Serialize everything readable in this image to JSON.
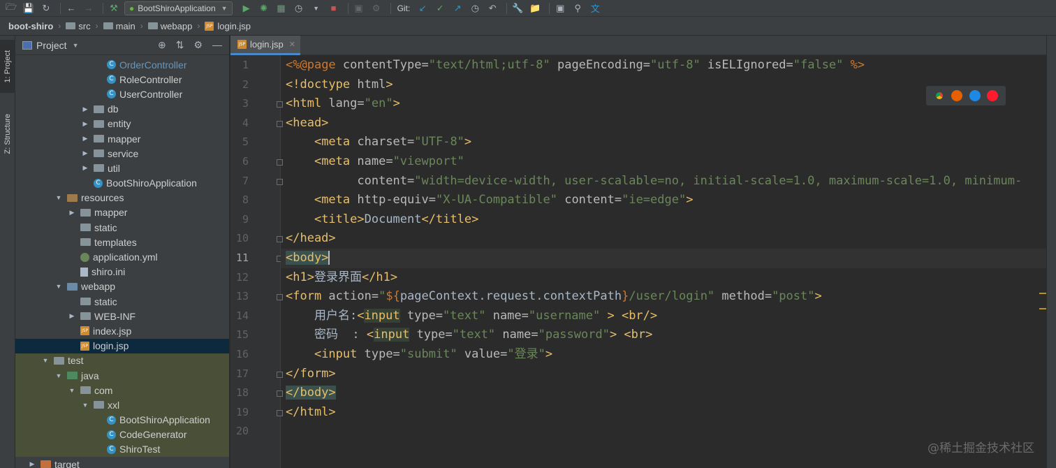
{
  "toolbar": {
    "run_config": "BootShiroApplication",
    "git_label": "Git:"
  },
  "breadcrumb": [
    "boot-shiro",
    "src",
    "main",
    "webapp",
    "login.jsp"
  ],
  "left_stripe": {
    "project_tab": "1: Project",
    "structure_tab": "Z: Structure"
  },
  "project_panel": {
    "title": "Project",
    "tree": [
      {
        "label": "OrderController",
        "icon": "class-icon",
        "depth": 4,
        "arrow": "",
        "style": "link"
      },
      {
        "label": "RoleController",
        "icon": "class-icon",
        "depth": 4,
        "arrow": "",
        "style": ""
      },
      {
        "label": "UserController",
        "icon": "class-icon",
        "depth": 4,
        "arrow": "",
        "style": ""
      },
      {
        "label": "db",
        "icon": "folder-icon",
        "depth": 3,
        "arrow": "collapsed",
        "style": ""
      },
      {
        "label": "entity",
        "icon": "folder-icon",
        "depth": 3,
        "arrow": "collapsed",
        "style": ""
      },
      {
        "label": "mapper",
        "icon": "folder-icon",
        "depth": 3,
        "arrow": "collapsed",
        "style": ""
      },
      {
        "label": "service",
        "icon": "folder-icon",
        "depth": 3,
        "arrow": "collapsed",
        "style": ""
      },
      {
        "label": "util",
        "icon": "folder-icon",
        "depth": 3,
        "arrow": "collapsed",
        "style": ""
      },
      {
        "label": "BootShiroApplication",
        "icon": "class-icon",
        "depth": 3,
        "arrow": "",
        "style": ""
      },
      {
        "label": "resources",
        "icon": "resources-folder-icon",
        "depth": 1,
        "arrow": "expanded",
        "style": ""
      },
      {
        "label": "mapper",
        "icon": "folder-icon",
        "depth": 2,
        "arrow": "collapsed",
        "style": ""
      },
      {
        "label": "static",
        "icon": "folder-icon",
        "depth": 2,
        "arrow": "",
        "style": ""
      },
      {
        "label": "templates",
        "icon": "folder-icon",
        "depth": 2,
        "arrow": "",
        "style": ""
      },
      {
        "label": "application.yml",
        "icon": "yml-file-icon",
        "depth": 2,
        "arrow": "",
        "style": ""
      },
      {
        "label": "shiro.ini",
        "icon": "ini-file-icon",
        "depth": 2,
        "arrow": "",
        "style": ""
      },
      {
        "label": "webapp",
        "icon": "web-folder-icon",
        "depth": 1,
        "arrow": "expanded",
        "style": ""
      },
      {
        "label": "static",
        "icon": "folder-icon",
        "depth": 2,
        "arrow": "",
        "style": ""
      },
      {
        "label": "WEB-INF",
        "icon": "folder-icon",
        "depth": 2,
        "arrow": "collapsed",
        "style": ""
      },
      {
        "label": "index.jsp",
        "icon": "jsp-file-icon",
        "depth": 2,
        "arrow": "",
        "style": ""
      },
      {
        "label": "login.jsp",
        "icon": "jsp-file-icon",
        "depth": 2,
        "arrow": "",
        "style": "selected"
      },
      {
        "label": "test",
        "icon": "folder-icon",
        "depth": 0,
        "arrow": "expanded",
        "style": "test"
      },
      {
        "label": "java",
        "icon": "test-source-folder-icon",
        "depth": 1,
        "arrow": "expanded",
        "style": "test"
      },
      {
        "label": "com",
        "icon": "package-icon",
        "depth": 2,
        "arrow": "expanded",
        "style": "test"
      },
      {
        "label": "xxl",
        "icon": "package-icon",
        "depth": 3,
        "arrow": "expanded",
        "style": "test"
      },
      {
        "label": "BootShiroApplication",
        "icon": "class-icon",
        "depth": 4,
        "arrow": "",
        "style": "test"
      },
      {
        "label": "CodeGenerator",
        "icon": "class-icon",
        "depth": 4,
        "arrow": "",
        "style": "test"
      },
      {
        "label": "ShiroTest",
        "icon": "class-icon",
        "depth": 4,
        "arrow": "",
        "style": "test"
      },
      {
        "label": "target",
        "icon": "excluded-folder-icon",
        "depth": -1,
        "arrow": "collapsed",
        "style": ""
      }
    ]
  },
  "editor": {
    "tab_label": "login.jsp",
    "current_line": 11,
    "lines": [
      [
        [
          "t-dir",
          "<%@"
        ],
        [
          "t-dir",
          "page"
        ],
        [
          "t-attr",
          " contentType="
        ],
        [
          "t-val",
          "\"text/html;utf-8\""
        ],
        [
          "t-attr",
          " pageEncoding="
        ],
        [
          "t-val",
          "\"utf-8\""
        ],
        [
          "t-attr",
          " isELIgnored="
        ],
        [
          "t-val",
          "\"false\""
        ],
        [
          "t-dir",
          " %>"
        ]
      ],
      [
        [
          "t-tag",
          "<!doctype "
        ],
        [
          "t-attr",
          "html"
        ],
        [
          "t-tag",
          ">"
        ]
      ],
      [
        [
          "t-tag",
          "<html "
        ],
        [
          "t-attr",
          "lang="
        ],
        [
          "t-val",
          "\"en\""
        ],
        [
          "t-tag",
          ">"
        ]
      ],
      [
        [
          "t-tag",
          "<head>"
        ]
      ],
      [
        [
          "t-txt",
          "    "
        ],
        [
          "t-tag",
          "<meta "
        ],
        [
          "t-attr",
          "charset="
        ],
        [
          "t-val",
          "\"UTF-8\""
        ],
        [
          "t-tag",
          ">"
        ]
      ],
      [
        [
          "t-txt",
          "    "
        ],
        [
          "t-tag",
          "<meta "
        ],
        [
          "t-attr",
          "name="
        ],
        [
          "t-val",
          "\"viewport\""
        ]
      ],
      [
        [
          "t-txt",
          "          "
        ],
        [
          "t-attr",
          "content="
        ],
        [
          "t-val",
          "\"width=device-width, user-scalable=no, initial-scale=1.0, maximum-scale=1.0, minimum-"
        ]
      ],
      [
        [
          "t-txt",
          "    "
        ],
        [
          "t-tag",
          "<meta "
        ],
        [
          "t-attr",
          "http-equiv="
        ],
        [
          "t-val",
          "\"X-UA-Compatible\""
        ],
        [
          "t-attr",
          " content="
        ],
        [
          "t-val",
          "\"ie=edge\""
        ],
        [
          "t-tag",
          ">"
        ]
      ],
      [
        [
          "t-txt",
          "    "
        ],
        [
          "t-tag",
          "<title>"
        ],
        [
          "t-txt",
          "Document"
        ],
        [
          "t-tag",
          "</title>"
        ]
      ],
      [
        [
          "t-tag",
          "</head>"
        ]
      ],
      [
        [
          "t-tag hl",
          "<body>"
        ],
        [
          "caret",
          ""
        ]
      ],
      [
        [
          "t-tag",
          "<h1>"
        ],
        [
          "t-txt",
          "登录界面"
        ],
        [
          "t-tag",
          "</h1>"
        ]
      ],
      [
        [
          "t-tag",
          "<form "
        ],
        [
          "t-attr",
          "action="
        ],
        [
          "t-val",
          "\""
        ],
        [
          "t-tpl",
          "${"
        ],
        [
          "t-txt",
          "pageContext.request.contextPath"
        ],
        [
          "t-tpl",
          "}"
        ],
        [
          "t-val",
          "/user/login\""
        ],
        [
          "t-attr",
          " method="
        ],
        [
          "t-val",
          "\"post\""
        ],
        [
          "t-tag",
          ">"
        ]
      ],
      [
        [
          "t-txt",
          "    用户名:"
        ],
        [
          "t-tag",
          "<"
        ],
        [
          "t-tag hl2",
          "input"
        ],
        [
          "t-attr",
          " type="
        ],
        [
          "t-val",
          "\"text\""
        ],
        [
          "t-attr",
          " name="
        ],
        [
          "t-val",
          "\"username\""
        ],
        [
          "t-tag",
          " > <br/>"
        ]
      ],
      [
        [
          "t-txt",
          "    密码  : "
        ],
        [
          "t-tag",
          "<"
        ],
        [
          "t-tag hl2",
          "input"
        ],
        [
          "t-attr",
          " type="
        ],
        [
          "t-val",
          "\"text\""
        ],
        [
          "t-attr",
          " name="
        ],
        [
          "t-val",
          "\"password\""
        ],
        [
          "t-tag",
          "> <br>"
        ]
      ],
      [
        [
          "t-txt",
          "    "
        ],
        [
          "t-tag",
          "<input "
        ],
        [
          "t-attr",
          "type="
        ],
        [
          "t-val",
          "\"submit\""
        ],
        [
          "t-attr",
          " value="
        ],
        [
          "t-val",
          "\"登录\""
        ],
        [
          "t-tag",
          ">"
        ]
      ],
      [
        [
          "t-tag",
          "</form>"
        ]
      ],
      [
        [
          "t-tag hl",
          "</body>"
        ]
      ],
      [
        [
          "t-tag",
          "</html>"
        ]
      ],
      []
    ]
  },
  "watermark": "@稀土掘金技术社区"
}
